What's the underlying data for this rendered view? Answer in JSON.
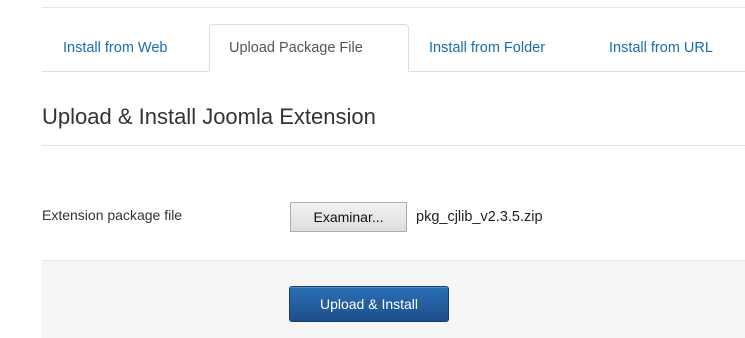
{
  "tabs": [
    {
      "label": "Install from Web",
      "active": false
    },
    {
      "label": "Upload Package File",
      "active": true
    },
    {
      "label": "Install from Folder",
      "active": false
    },
    {
      "label": "Install from URL",
      "active": false
    }
  ],
  "form": {
    "legend": "Upload & Install Joomla Extension",
    "file_label": "Extension package file",
    "browse_label": "Examinar...",
    "file_name": "pkg_cjlib_v2.3.5.zip",
    "submit_label": "Upload & Install"
  },
  "colors": {
    "link": "#1a6db0",
    "primary_button": "#1d5a9c",
    "actions_bg": "#f5f5f5"
  }
}
